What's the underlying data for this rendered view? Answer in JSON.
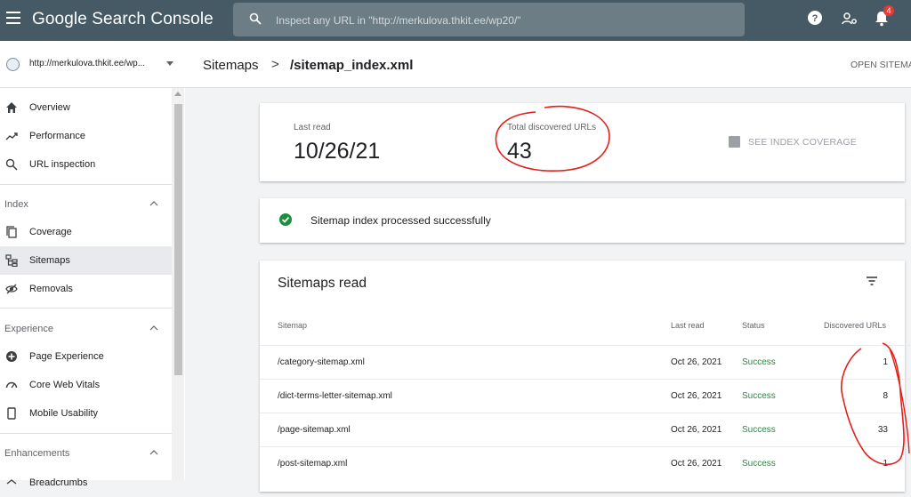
{
  "app": {
    "title": "Google Search Console",
    "search_placeholder": "Inspect any URL in \"http://merkulova.thkit.ee/wp20/\"",
    "notification_count": "4"
  },
  "property": {
    "url": "http://merkulova.thkit.ee/wp..."
  },
  "sidebar": {
    "top_items": [
      {
        "label": "Overview",
        "icon": "home-icon"
      },
      {
        "label": "Performance",
        "icon": "trending-up-icon"
      },
      {
        "label": "URL inspection",
        "icon": "search-icon"
      }
    ],
    "index": {
      "header": "Index",
      "items": [
        {
          "label": "Coverage",
          "icon": "copy-icon"
        },
        {
          "label": "Sitemaps",
          "icon": "sitemap-icon"
        },
        {
          "label": "Removals",
          "icon": "eye-off-icon"
        }
      ]
    },
    "experience": {
      "header": "Experience",
      "items": [
        {
          "label": "Page Experience",
          "icon": "plus-circle-icon"
        },
        {
          "label": "Core Web Vitals",
          "icon": "gauge-icon"
        },
        {
          "label": "Mobile Usability",
          "icon": "phone-icon"
        }
      ]
    },
    "enhancements": {
      "header": "Enhancements",
      "partial_item": "Breadcrumbs"
    }
  },
  "breadcrumb": {
    "parent": "Sitemaps",
    "separator": ">",
    "current": "/sitemap_index.xml"
  },
  "header_action": "OPEN SITEMAP",
  "stats": {
    "last_read_label": "Last read",
    "last_read_value": "10/26/21",
    "discovered_label": "Total discovered URLs",
    "discovered_value": "43",
    "coverage_button": "SEE INDEX COVERAGE"
  },
  "status_message": "Sitemap index processed successfully",
  "table": {
    "title": "Sitemaps read",
    "headers": {
      "sitemap": "Sitemap",
      "last_read": "Last read",
      "status": "Status",
      "urls": "Discovered URLs"
    },
    "rows": [
      {
        "sitemap": "/category-sitemap.xml",
        "last_read": "Oct 26, 2021",
        "status": "Success",
        "urls": "1"
      },
      {
        "sitemap": "/dict-terms-letter-sitemap.xml",
        "last_read": "Oct 26, 2021",
        "status": "Success",
        "urls": "8"
      },
      {
        "sitemap": "/page-sitemap.xml",
        "last_read": "Oct 26, 2021",
        "status": "Success",
        "urls": "33"
      },
      {
        "sitemap": "/post-sitemap.xml",
        "last_read": "Oct 26, 2021",
        "status": "Success",
        "urls": "1"
      }
    ]
  },
  "colors": {
    "topbar": "#455a64",
    "success": "#1e8e3e",
    "annotation": "#e0201a"
  }
}
